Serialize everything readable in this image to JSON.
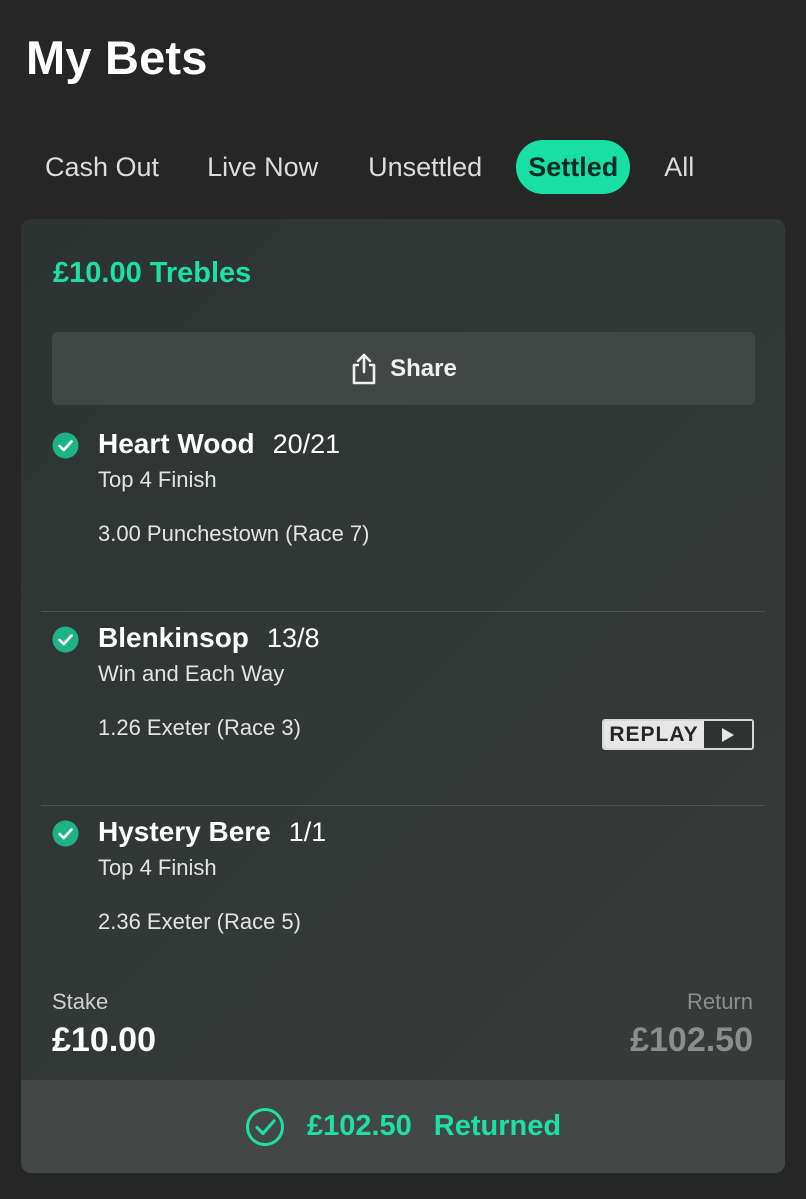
{
  "header": {
    "title": "My Bets"
  },
  "tabs": [
    {
      "label": "Cash Out",
      "active": false
    },
    {
      "label": "Live Now",
      "active": false
    },
    {
      "label": "Unsettled",
      "active": false
    },
    {
      "label": "Settled",
      "active": true
    },
    {
      "label": "All",
      "active": false
    }
  ],
  "bet": {
    "title": "£10.00 Trebles",
    "share_label": "Share",
    "selections": [
      {
        "name": "Heart Wood",
        "odds": "20/21",
        "market": "Top 4 Finish",
        "event": "3.00 Punchestown (Race 7)",
        "status_icon": "check-circle-icon"
      },
      {
        "name": "Blenkinsop",
        "odds": "13/8",
        "market": "Win and Each Way",
        "event": "1.26 Exeter (Race 3)",
        "status_icon": "check-circle-icon",
        "replay_label": "REPLAY"
      },
      {
        "name": "Hystery Bere",
        "odds": "1/1",
        "market": "Top 4 Finish",
        "event": "2.36 Exeter (Race 5)",
        "status_icon": "check-circle-icon"
      }
    ],
    "stake_label": "Stake",
    "stake_value": "£10.00",
    "return_label": "Return",
    "return_value": "£102.50",
    "returned_amount": "£102.50",
    "returned_text": "Returned"
  },
  "colors": {
    "accent": "#1ee0a4",
    "background": "#262626",
    "card": "#333937"
  }
}
